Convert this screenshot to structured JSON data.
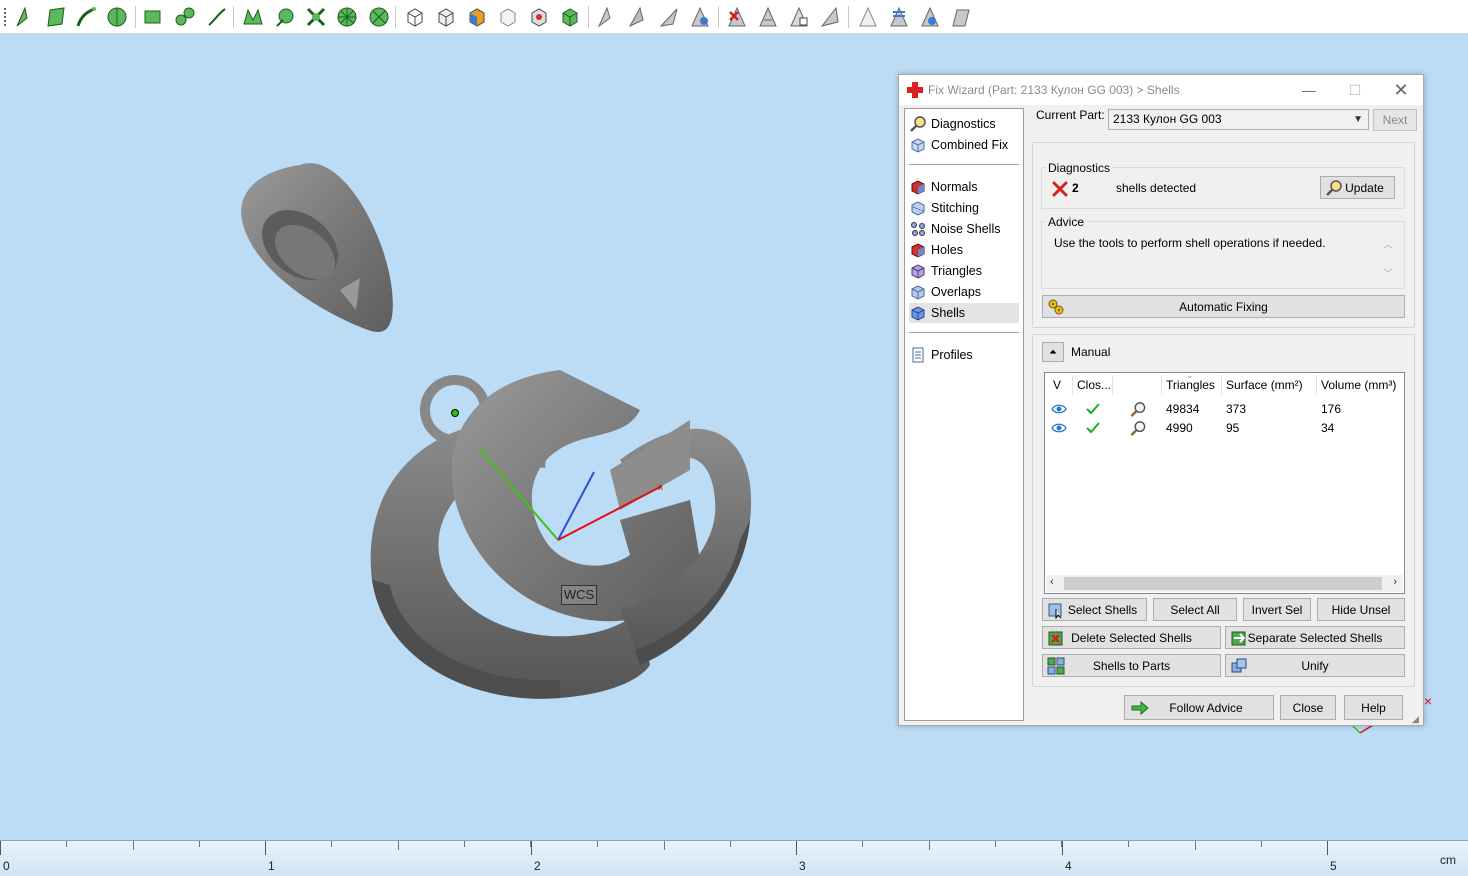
{
  "toolbar": {
    "buttons": [
      {
        "name": "select-triangles-icon"
      },
      {
        "name": "select-surface-icon"
      },
      {
        "name": "select-curve-icon"
      },
      {
        "name": "select-shell-icon"
      },
      {
        "name": "rect-select-icon"
      },
      {
        "name": "lasso-select-icon"
      },
      {
        "name": "brush-select-icon"
      },
      {
        "name": "mesh-tool-1-icon"
      },
      {
        "name": "mesh-tool-2-icon"
      },
      {
        "name": "mesh-tool-3-icon"
      },
      {
        "name": "mesh-tool-4-icon"
      },
      {
        "name": "mesh-tool-5-icon"
      },
      {
        "name": "cube-view-1-icon"
      },
      {
        "name": "cube-view-2-icon"
      },
      {
        "name": "cube-view-3-icon"
      },
      {
        "name": "cube-view-4-icon"
      },
      {
        "name": "cube-view-5-icon"
      },
      {
        "name": "cube-view-6-icon"
      },
      {
        "name": "triangle-tool-1-icon"
      },
      {
        "name": "triangle-tool-2-icon"
      },
      {
        "name": "triangle-tool-3-icon"
      },
      {
        "name": "triangle-tool-4-icon"
      },
      {
        "name": "delete-triangle-icon"
      },
      {
        "name": "triangle-tool-5-icon"
      },
      {
        "name": "triangle-tool-6-icon"
      },
      {
        "name": "triangle-tool-7-icon"
      },
      {
        "name": "triangle-tool-8-icon"
      },
      {
        "name": "triangle-tool-9-icon"
      },
      {
        "name": "triangle-tool-10-icon"
      },
      {
        "name": "triangle-tool-11-icon"
      }
    ]
  },
  "viewport": {
    "wcs_label": "WCS",
    "axis_colors": {
      "x": "#e01010",
      "y": "#3fc21a",
      "z": "#2a4fd8"
    },
    "background": "#bcdcf5",
    "model_color": "#7d7d7d"
  },
  "ruler": {
    "labels": [
      "0",
      "1",
      "2",
      "3",
      "4",
      "5"
    ],
    "unit": "cm"
  },
  "dialog": {
    "title": "Fix Wizard (Part: 2133 Кулон GG 003) > Shells",
    "nav": {
      "top": [
        {
          "label": "Diagnostics",
          "icon": "magnifier-icon"
        },
        {
          "label": "Combined Fix",
          "icon": "cube-fix-icon"
        }
      ],
      "steps": [
        {
          "label": "Normals",
          "icon": "normals-icon"
        },
        {
          "label": "Stitching",
          "icon": "stitching-icon"
        },
        {
          "label": "Noise Shells",
          "icon": "noise-shells-icon"
        },
        {
          "label": "Holes",
          "icon": "holes-icon"
        },
        {
          "label": "Triangles",
          "icon": "triangles-icon"
        },
        {
          "label": "Overlaps",
          "icon": "overlaps-icon"
        },
        {
          "label": "Shells",
          "icon": "shells-icon"
        }
      ],
      "bottom": [
        {
          "label": "Profiles",
          "icon": "profiles-icon"
        }
      ],
      "active": "Shells"
    },
    "current_part_label": "Current Part:",
    "current_part_value": "2133 Кулон GG 003",
    "next_label": "Next",
    "diagnostics": {
      "title": "Diagnostics",
      "count": "2",
      "text": "shells detected",
      "update_label": "Update"
    },
    "advice": {
      "title": "Advice",
      "text": "Use the tools to perform shell operations if needed.",
      "automatic_fixing_label": "Automatic Fixing"
    },
    "manual": {
      "title": "Manual",
      "columns": [
        "V",
        "Clos...",
        "",
        "Triangles",
        "Surface (mm²)",
        "Volume (mm³)"
      ],
      "rows": [
        {
          "triangles": "49834",
          "surface": "373",
          "volume": "176"
        },
        {
          "triangles": "4990",
          "surface": "95",
          "volume": "34"
        }
      ],
      "buttons": {
        "select_shells": "Select Shells",
        "select_all": "Select All",
        "invert_sel": "Invert Sel",
        "hide_unsel": "Hide Unsel",
        "delete_selected": "Delete Selected Shells",
        "separate_selected": "Separate Selected Shells",
        "shells_to_parts": "Shells to Parts",
        "unify": "Unify"
      }
    },
    "footer": {
      "follow_advice": "Follow Advice",
      "close": "Close",
      "help": "Help"
    }
  }
}
